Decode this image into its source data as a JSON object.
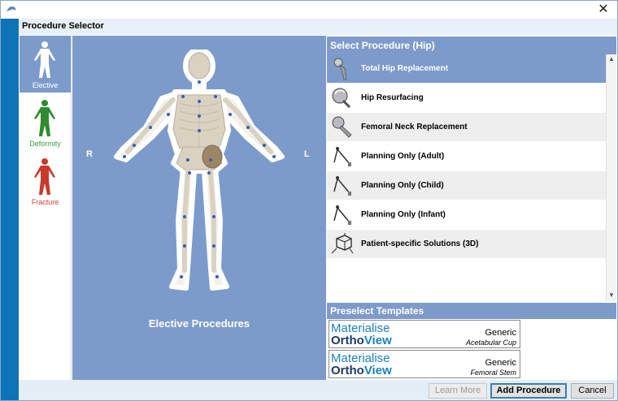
{
  "window": {
    "title": "Procedure Selector",
    "close_glyph": "✕"
  },
  "categories": [
    {
      "label": "Elective",
      "color": "#ffffff",
      "selected": true
    },
    {
      "label": "Deformity",
      "color": "#3a9a3a",
      "selected": false
    },
    {
      "label": "Fracture",
      "color": "#d04030",
      "selected": false
    }
  ],
  "body_view": {
    "right_label": "R",
    "left_label": "L",
    "caption": "Elective Procedures"
  },
  "procedures": {
    "header": "Select Procedure (Hip)",
    "items": [
      {
        "label": "Total Hip Replacement",
        "icon": "hip-stem-icon",
        "selected": true
      },
      {
        "label": "Hip Resurfacing",
        "icon": "resurfacing-cap-icon",
        "selected": false
      },
      {
        "label": "Femoral Neck Replacement",
        "icon": "femoral-neck-icon",
        "selected": false
      },
      {
        "label": "Planning Only (Adult)",
        "icon": "compass-icon",
        "selected": false
      },
      {
        "label": "Planning Only (Child)",
        "icon": "compass-icon",
        "selected": false
      },
      {
        "label": "Planning Only (Infant)",
        "icon": "compass-icon",
        "selected": false
      },
      {
        "label": "Patient-specific Solutions (3D)",
        "icon": "cube-3d-icon",
        "selected": false
      }
    ]
  },
  "templates": {
    "header": "Preselect Templates",
    "items": [
      {
        "brand_top": "Materialise",
        "brand_bottom_a": "Ortho",
        "brand_bottom_b": "View",
        "generic": "Generic",
        "type": "Acetabular Cup"
      },
      {
        "brand_top": "Materialise",
        "brand_bottom_a": "Ortho",
        "brand_bottom_b": "View",
        "generic": "Generic",
        "type": "Femoral Stem"
      }
    ]
  },
  "buttons": {
    "learn_more": "Learn More",
    "add_procedure": "Add Procedure",
    "cancel": "Cancel"
  }
}
